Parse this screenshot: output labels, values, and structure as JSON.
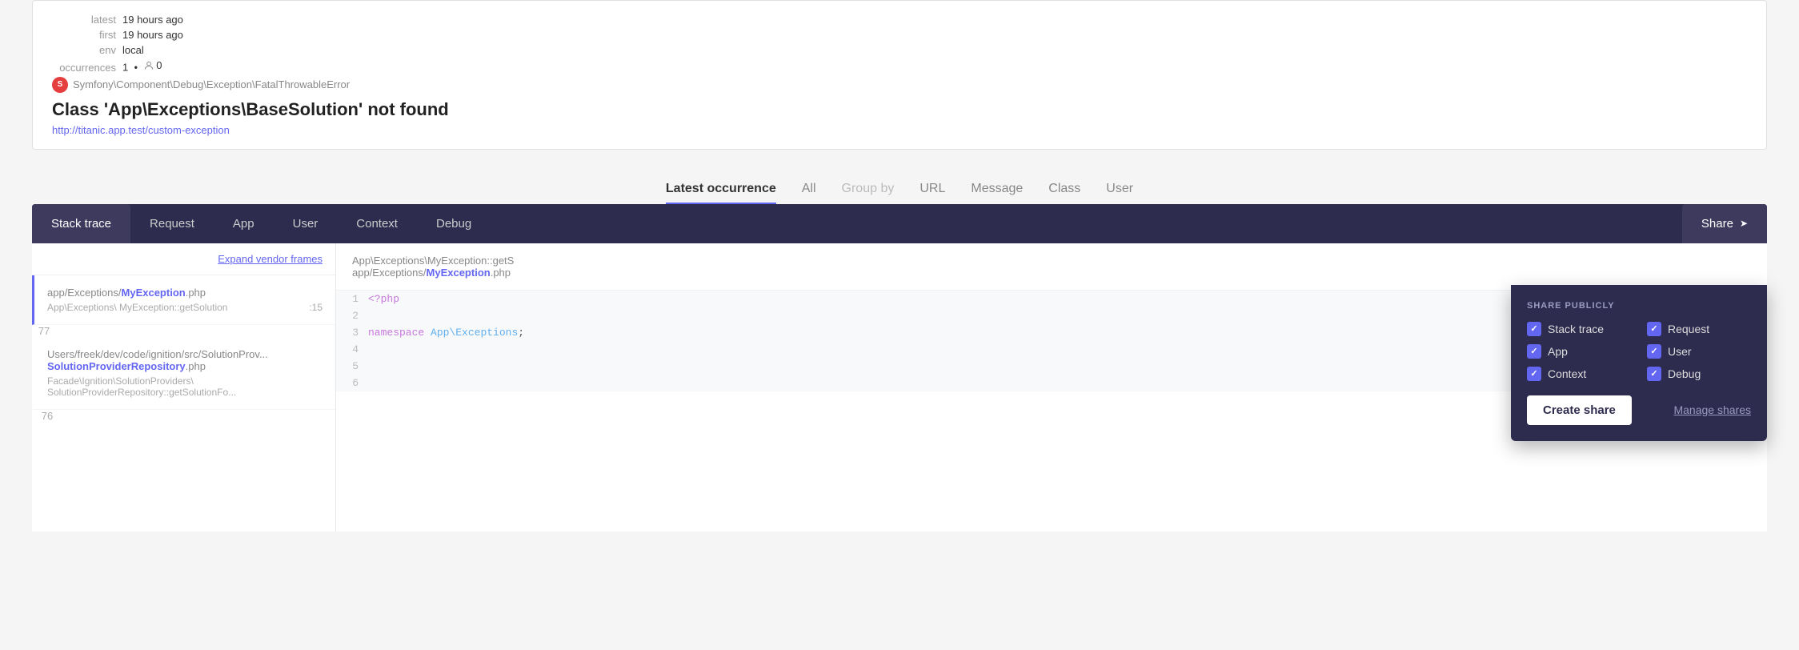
{
  "meta": {
    "latest_label": "latest",
    "latest_value": "19 hours ago",
    "first_label": "first",
    "first_value": "19 hours ago",
    "env_label": "env",
    "env_value": "local",
    "occurrences_label": "occurrences",
    "occurrences_value": "1",
    "user_count": "0"
  },
  "exception": {
    "namespace": "Symfony\\Component\\Debug\\Exception\\FatalThrowableError",
    "title": "Class 'App\\Exceptions\\BaseSolution' not found",
    "url": "http://titanic.app.test/custom-exception"
  },
  "nav_tabs": [
    {
      "id": "latest",
      "label": "Latest occurrence",
      "active": true
    },
    {
      "id": "all",
      "label": "All",
      "active": false
    },
    {
      "id": "groupby",
      "label": "Group by",
      "active": false,
      "disabled": true
    },
    {
      "id": "url",
      "label": "URL",
      "active": false
    },
    {
      "id": "message",
      "label": "Message",
      "active": false
    },
    {
      "id": "class",
      "label": "Class",
      "active": false
    },
    {
      "id": "user",
      "label": "User",
      "active": false
    }
  ],
  "panel_tabs": [
    {
      "id": "stacktrace",
      "label": "Stack trace",
      "active": true
    },
    {
      "id": "request",
      "label": "Request",
      "active": false
    },
    {
      "id": "app",
      "label": "App",
      "active": false
    },
    {
      "id": "user",
      "label": "User",
      "active": false
    },
    {
      "id": "context",
      "label": "Context",
      "active": false
    },
    {
      "id": "debug",
      "label": "Debug",
      "active": false
    },
    {
      "id": "share",
      "label": "Share",
      "active": false
    }
  ],
  "expand_vendor": "Expand vendor frames",
  "stack_items": [
    {
      "file": "app/Exceptions/<strong>MyException</strong>.php",
      "func": "App\\Exceptions\\ MyException::getSolution",
      "line": ":15",
      "number": "77",
      "active": true
    },
    {
      "file": "Users/freek/dev/code/ignition/src/SolutionProv<wbr>SolutionProviderRepository.php",
      "func": "Facade\\Ignition\\SolutionProviders\\ SolutionProviderRepository::getSolutionFo...",
      "line": "",
      "number": "76",
      "active": false
    }
  ],
  "code_header": {
    "func": "App\\Exceptions\\MyException::getS",
    "file": "app/Exceptions/<strong>MyException</strong>.php"
  },
  "code_lines": [
    {
      "num": "1",
      "content": "<?php"
    },
    {
      "num": "2",
      "content": ""
    },
    {
      "num": "3",
      "content": "namespace App\\Exceptions;"
    },
    {
      "num": "4",
      "content": ""
    },
    {
      "num": "5",
      "content": ""
    },
    {
      "num": "6",
      "content": ""
    }
  ],
  "share_dropdown": {
    "title": "SHARE PUBLICLY",
    "options": [
      {
        "id": "stacktrace",
        "label": "Stack trace",
        "checked": true
      },
      {
        "id": "request",
        "label": "Request",
        "checked": true
      },
      {
        "id": "app",
        "label": "App",
        "checked": true
      },
      {
        "id": "user",
        "label": "User",
        "checked": true
      },
      {
        "id": "context",
        "label": "Context",
        "checked": true
      },
      {
        "id": "debug",
        "label": "Debug",
        "checked": true
      }
    ],
    "create_button": "Create share",
    "manage_link": "Manage shares"
  }
}
